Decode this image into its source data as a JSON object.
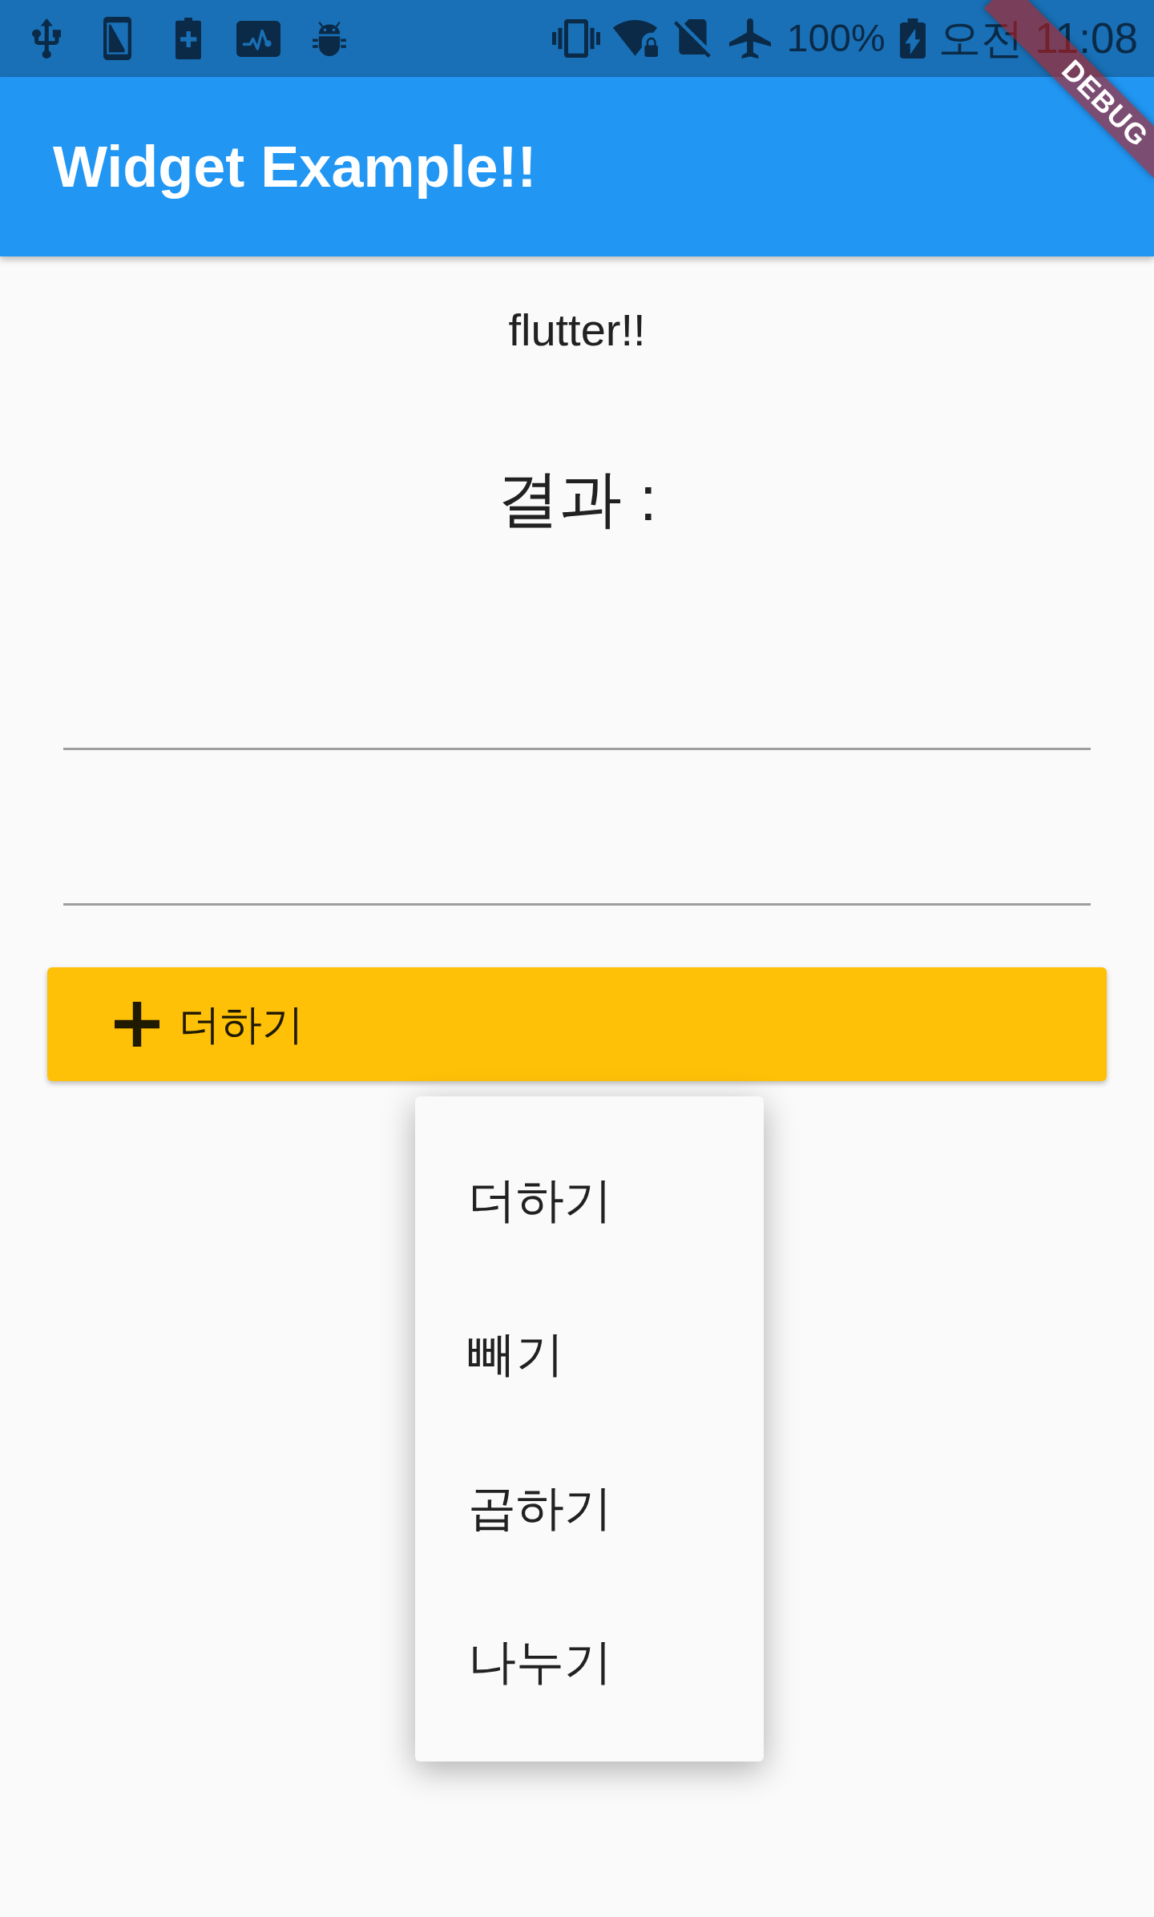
{
  "status_bar": {
    "battery_text": "100%",
    "time": "오전 11:08"
  },
  "app_bar": {
    "title": "Widget Example!!"
  },
  "debug_banner": {
    "label": "DEBUG"
  },
  "body": {
    "caption": "flutter!!",
    "result_label": "결과 :"
  },
  "text_fields": [
    {
      "focused": false
    },
    {
      "focused": false
    }
  ],
  "dropdown_button": {
    "value": "더하기"
  },
  "dropdown_menu": {
    "items": [
      {
        "label": "더하기"
      },
      {
        "label": "빼기"
      },
      {
        "label": "곱하기"
      },
      {
        "label": "나누기"
      }
    ]
  }
}
